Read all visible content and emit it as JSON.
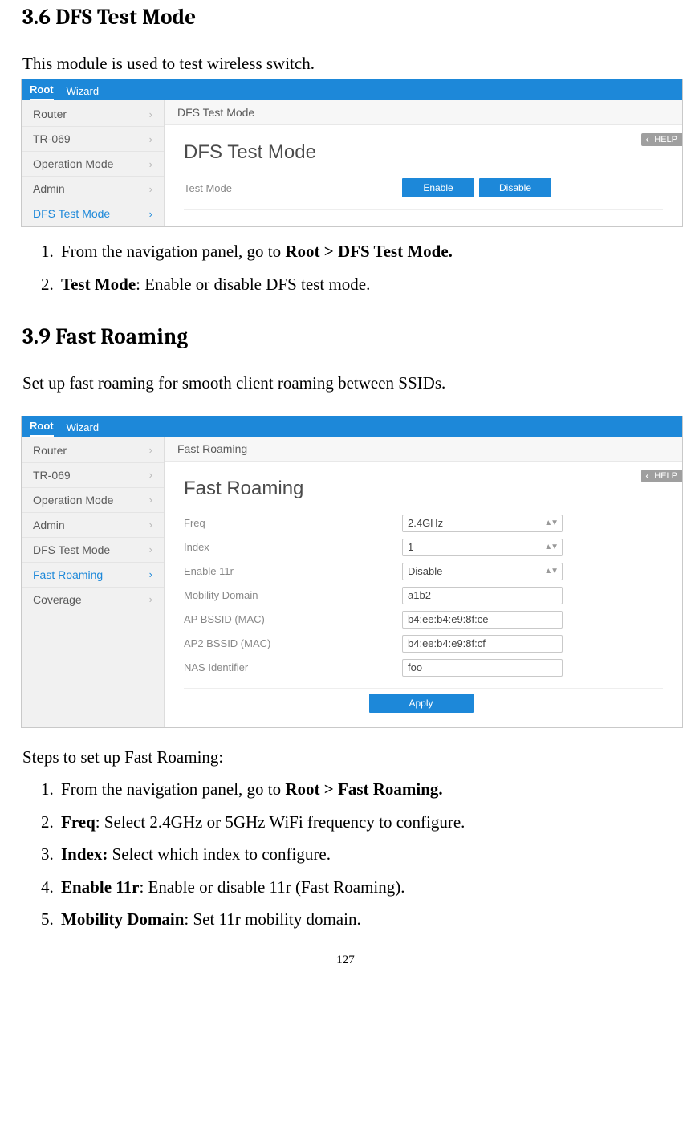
{
  "section1": {
    "heading": "3.6 DFS Test Mode",
    "intro": "This module is used to test wireless switch.",
    "steps": [
      {
        "prefix": "From the navigation panel, go to ",
        "bold": "Root > DFS Test Mode."
      },
      {
        "bold_lead": "Test Mode",
        "rest": ": Enable or disable DFS test mode."
      }
    ]
  },
  "shot1": {
    "tabs": {
      "root": "Root",
      "wizard": "Wizard"
    },
    "sidebar": [
      "Router",
      "TR-069",
      "Operation Mode",
      "Admin",
      "DFS Test Mode"
    ],
    "active_index": 4,
    "breadcrumb": "DFS Test Mode",
    "title": "DFS Test Mode",
    "help": "HELP",
    "row_label": "Test Mode",
    "btn_enable": "Enable",
    "btn_disable": "Disable"
  },
  "section2": {
    "heading": "3.9 Fast Roaming",
    "intro": "Set up fast roaming for smooth client roaming between SSIDs.",
    "steps_caption": "Steps to set up Fast Roaming:",
    "steps": [
      {
        "prefix": "From the navigation panel, go to ",
        "bold": "Root > Fast Roaming."
      },
      {
        "bold_lead": "Freq",
        "rest": ": Select 2.4GHz or 5GHz WiFi frequency to configure."
      },
      {
        "bold_lead": "Index:",
        "rest": " Select which index to configure."
      },
      {
        "bold_lead": "Enable 11r",
        "rest": ": Enable or disable 11r (Fast Roaming)."
      },
      {
        "bold_lead": "Mobility Domain",
        "rest": ": Set 11r mobility domain."
      }
    ]
  },
  "shot2": {
    "tabs": {
      "root": "Root",
      "wizard": "Wizard"
    },
    "sidebar": [
      "Router",
      "TR-069",
      "Operation Mode",
      "Admin",
      "DFS Test Mode",
      "Fast Roaming",
      "Coverage"
    ],
    "active_index": 5,
    "breadcrumb": "Fast Roaming",
    "title": "Fast Roaming",
    "help": "HELP",
    "fields": [
      {
        "label": "Freq",
        "value": "2.4GHz",
        "type": "select"
      },
      {
        "label": "Index",
        "value": "1",
        "type": "select"
      },
      {
        "label": "Enable 11r",
        "value": "Disable",
        "type": "select"
      },
      {
        "label": "Mobility Domain",
        "value": "a1b2",
        "type": "text"
      },
      {
        "label": "AP BSSID (MAC)",
        "value": "b4:ee:b4:e9:8f:ce",
        "type": "text"
      },
      {
        "label": "AP2 BSSID (MAC)",
        "value": "b4:ee:b4:e9:8f:cf",
        "type": "text"
      },
      {
        "label": "NAS Identifier",
        "value": "foo",
        "type": "text"
      }
    ],
    "apply": "Apply"
  },
  "page_number": "127"
}
